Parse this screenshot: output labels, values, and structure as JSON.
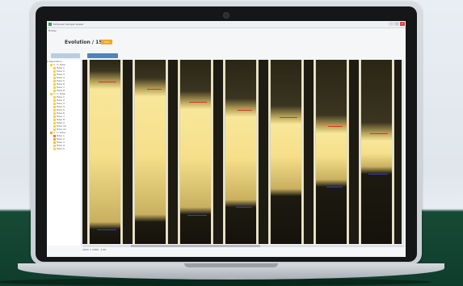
{
  "window": {
    "title": "Turbiscan Sample Viewer",
    "menu": "Fichier",
    "controls": [
      "–",
      "□",
      "×"
    ]
  },
  "header": {
    "sample_title": "Evolution / 15",
    "tag_label": "Test"
  },
  "toolbar": {
    "button_1": "",
    "button_2": ""
  },
  "tree": {
    "root": "Séparation",
    "items": [
      {
        "label": "1 / 1 Tube",
        "color": "#f0d24a"
      },
      {
        "label": "Tube 1",
        "color": "#f0d24a"
      },
      {
        "label": "Tube 2",
        "color": "#f0d24a"
      },
      {
        "label": "Tube 3",
        "color": "#f0d24a"
      },
      {
        "label": "Tube 4",
        "color": "#f0d24a"
      },
      {
        "label": "Tube 5",
        "color": "#f0d24a"
      },
      {
        "label": "Tube 6",
        "color": "#f0d24a"
      },
      {
        "label": "Tube 7",
        "color": "#f0d24a"
      },
      {
        "label": "Tube 8",
        "color": "#f0d24a"
      },
      {
        "label": "2 / 1 Tube",
        "color": "#f0d24a"
      },
      {
        "label": "Tube 1",
        "color": "#f0d24a"
      },
      {
        "label": "Tube 2",
        "color": "#f0d24a"
      },
      {
        "label": "Tube 3",
        "color": "#f0d24a"
      },
      {
        "label": "Tube 4",
        "color": "#f0d24a"
      },
      {
        "label": "Tube 5",
        "color": "#f0d24a"
      },
      {
        "label": "Tube 6",
        "color": "#f0d24a"
      },
      {
        "label": "Tube 7",
        "color": "#f0d24a"
      },
      {
        "label": "Tube 8",
        "color": "#f0d24a"
      },
      {
        "label": "Tube 9",
        "color": "#f0d24a"
      },
      {
        "label": "Tube 10",
        "color": "#f0d24a"
      },
      {
        "label": "Tube 11",
        "color": "#f0d24a"
      },
      {
        "label": "3 / 1 Tube",
        "color": "#f0a72a"
      },
      {
        "label": "Tube 1",
        "color": "#f07b2a"
      },
      {
        "label": "Tube 2",
        "color": "#f0a72a"
      },
      {
        "label": "Tube 3",
        "color": "#f0c22a"
      },
      {
        "label": "Tube 4",
        "color": "#f0d24a"
      },
      {
        "label": "Tube 5",
        "color": "#f0d24a"
      }
    ]
  },
  "tubes": [
    {
      "top_fraction": 0.12,
      "bottom_fraction": 0.92,
      "red_marker": 0.12,
      "blue_marker": 0.92
    },
    {
      "top_fraction": 0.16,
      "bottom_fraction": 0.88,
      "red_marker": 0.16,
      "blue_marker": null
    },
    {
      "top_fraction": 0.23,
      "bottom_fraction": 0.84,
      "red_marker": 0.23,
      "blue_marker": 0.84
    },
    {
      "top_fraction": 0.27,
      "bottom_fraction": 0.8,
      "red_marker": 0.27,
      "blue_marker": 0.8
    },
    {
      "top_fraction": 0.31,
      "bottom_fraction": 0.74,
      "red_marker": 0.31,
      "blue_marker": null
    },
    {
      "top_fraction": 0.36,
      "bottom_fraction": 0.69,
      "red_marker": 0.36,
      "blue_marker": 0.69
    },
    {
      "top_fraction": 0.4,
      "bottom_fraction": 0.62,
      "red_marker": 0.4,
      "blue_marker": 0.62
    }
  ],
  "colors": {
    "sample_fill": "#f5df8a",
    "sediment": "#1d1a10",
    "red_marker": "#e0302a",
    "blue_marker": "#3340c8",
    "accent": "#f0a72a",
    "primary_button": "#4f83b9"
  },
  "status": {
    "text": "1920 × 1080 · 1:00"
  }
}
